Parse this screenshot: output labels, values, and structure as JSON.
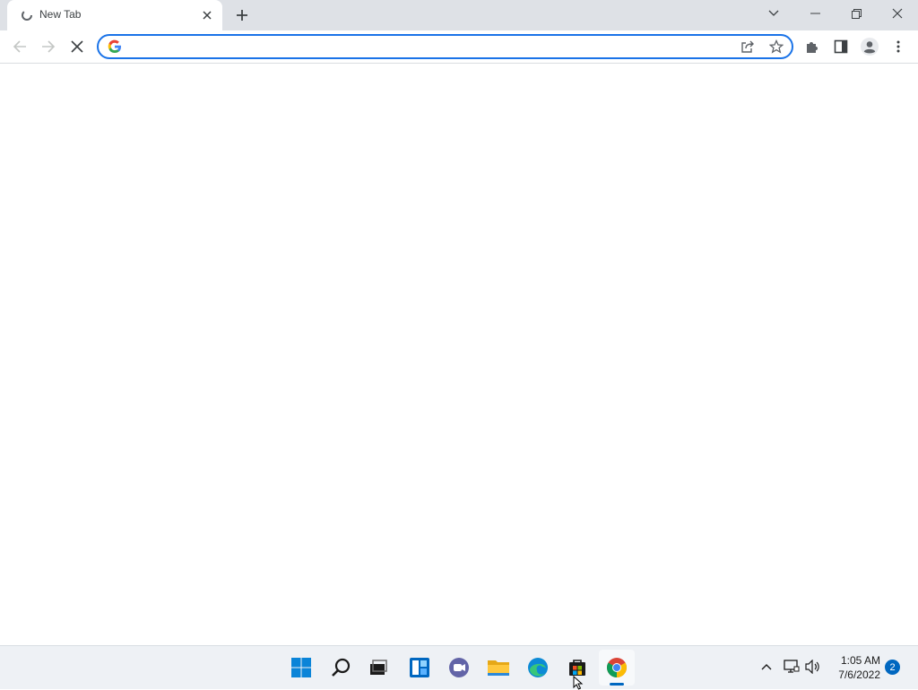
{
  "browser": {
    "tab": {
      "title": "New Tab",
      "favicon": "loading-icon"
    },
    "new_tab_icon": "plus-icon",
    "window_controls": [
      "tab-search-icon",
      "minimize-icon",
      "restore-icon",
      "close-icon"
    ]
  },
  "toolbar": {
    "back_icon": "back-arrow-icon",
    "forward_icon": "forward-arrow-icon",
    "stop_icon": "stop-loading-icon",
    "omnibox": {
      "value": "",
      "placeholder": "",
      "provider_icon": "google-g-icon",
      "share_icon": "share-icon",
      "bookmark_icon": "star-icon",
      "focused_border_color": "#1a73e8"
    },
    "extensions_icon": "puzzle-icon",
    "side_panel_icon": "side-panel-icon",
    "profile_icon": "avatar-icon",
    "menu_icon": "kebab-menu-icon"
  },
  "taskbar": {
    "apps": [
      {
        "name": "start",
        "icon": "windows-logo-icon"
      },
      {
        "name": "search",
        "icon": "search-icon"
      },
      {
        "name": "task-view",
        "icon": "task-view-icon"
      },
      {
        "name": "widgets",
        "icon": "widgets-icon"
      },
      {
        "name": "chat",
        "icon": "teams-chat-icon"
      },
      {
        "name": "file-explorer",
        "icon": "folder-icon"
      },
      {
        "name": "edge",
        "icon": "edge-icon"
      },
      {
        "name": "store",
        "icon": "store-icon"
      },
      {
        "name": "chrome",
        "icon": "chrome-icon",
        "active": true
      }
    ],
    "tray": {
      "chevron_icon": "chevron-up-icon",
      "network_icon": "network-icon",
      "volume_icon": "volume-icon",
      "time": "1:05 AM",
      "date": "7/6/2022",
      "notification_count": "2"
    },
    "accent_color": "#0067c0"
  }
}
